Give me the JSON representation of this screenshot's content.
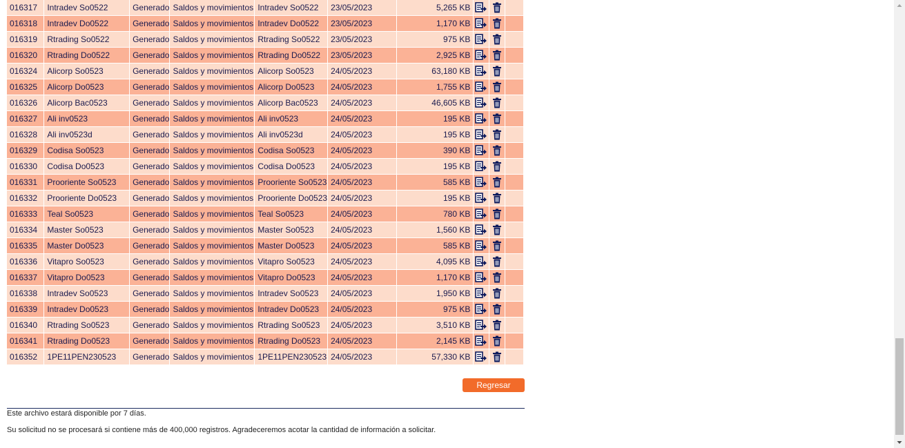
{
  "rows": [
    {
      "id": "016317",
      "name": "Intradev So0522",
      "status": "Generado",
      "type": "Saldos y movimientos",
      "file": "Intradev So0522",
      "date": "23/05/2023",
      "size": "5,265 KB"
    },
    {
      "id": "016318",
      "name": "Intradev Do0522",
      "status": "Generado",
      "type": "Saldos y movimientos",
      "file": "Intradev Do0522",
      "date": "23/05/2023",
      "size": "1,170 KB"
    },
    {
      "id": "016319",
      "name": "Rtrading So0522",
      "status": "Generado",
      "type": "Saldos y movimientos",
      "file": "Rtrading So0522",
      "date": "23/05/2023",
      "size": "975 KB"
    },
    {
      "id": "016320",
      "name": "Rtrading Do0522",
      "status": "Generado",
      "type": "Saldos y movimientos",
      "file": "Rtrading Do0522",
      "date": "23/05/2023",
      "size": "2,925 KB"
    },
    {
      "id": "016324",
      "name": "Alicorp So0523",
      "status": "Generado",
      "type": "Saldos y movimientos",
      "file": "Alicorp So0523",
      "date": "24/05/2023",
      "size": "63,180 KB"
    },
    {
      "id": "016325",
      "name": "Alicorp Do0523",
      "status": "Generado",
      "type": "Saldos y movimientos",
      "file": "Alicorp Do0523",
      "date": "24/05/2023",
      "size": "1,755 KB"
    },
    {
      "id": "016326",
      "name": "Alicorp Bac0523",
      "status": "Generado",
      "type": "Saldos y movimientos",
      "file": "Alicorp Bac0523",
      "date": "24/05/2023",
      "size": "46,605 KB"
    },
    {
      "id": "016327",
      "name": "Ali inv0523",
      "status": "Generado",
      "type": "Saldos y movimientos",
      "file": "Ali inv0523",
      "date": "24/05/2023",
      "size": "195 KB"
    },
    {
      "id": "016328",
      "name": "Ali inv0523d",
      "status": "Generado",
      "type": "Saldos y movimientos",
      "file": "Ali inv0523d",
      "date": "24/05/2023",
      "size": "195 KB"
    },
    {
      "id": "016329",
      "name": "Codisa So0523",
      "status": "Generado",
      "type": "Saldos y movimientos",
      "file": "Codisa So0523",
      "date": "24/05/2023",
      "size": "390 KB"
    },
    {
      "id": "016330",
      "name": "Codisa Do0523",
      "status": "Generado",
      "type": "Saldos y movimientos",
      "file": "Codisa Do0523",
      "date": "24/05/2023",
      "size": "195 KB"
    },
    {
      "id": "016331",
      "name": "Prooriente So0523",
      "status": "Generado",
      "type": "Saldos y movimientos",
      "file": "Prooriente So0523",
      "date": "24/05/2023",
      "size": "585 KB"
    },
    {
      "id": "016332",
      "name": "Prooriente Do0523",
      "status": "Generado",
      "type": "Saldos y movimientos",
      "file": "Prooriente Do0523",
      "date": "24/05/2023",
      "size": "195 KB"
    },
    {
      "id": "016333",
      "name": "Teal So0523",
      "status": "Generado",
      "type": "Saldos y movimientos",
      "file": "Teal So0523",
      "date": "24/05/2023",
      "size": "780 KB"
    },
    {
      "id": "016334",
      "name": "Master So0523",
      "status": "Generado",
      "type": "Saldos y movimientos",
      "file": "Master So0523",
      "date": "24/05/2023",
      "size": "1,560 KB"
    },
    {
      "id": "016335",
      "name": "Master Do0523",
      "status": "Generado",
      "type": "Saldos y movimientos",
      "file": "Master Do0523",
      "date": "24/05/2023",
      "size": "585 KB"
    },
    {
      "id": "016336",
      "name": "Vitapro So0523",
      "status": "Generado",
      "type": "Saldos y movimientos",
      "file": "Vitapro So0523",
      "date": "24/05/2023",
      "size": "4,095 KB"
    },
    {
      "id": "016337",
      "name": "Vitapro Do0523",
      "status": "Generado",
      "type": "Saldos y movimientos",
      "file": "Vitapro Do0523",
      "date": "24/05/2023",
      "size": "1,170 KB"
    },
    {
      "id": "016338",
      "name": "Intradev So0523",
      "status": "Generado",
      "type": "Saldos y movimientos",
      "file": "Intradev So0523",
      "date": "24/05/2023",
      "size": "1,950 KB"
    },
    {
      "id": "016339",
      "name": "Intradev Do0523",
      "status": "Generado",
      "type": "Saldos y movimientos",
      "file": "Intradev Do0523",
      "date": "24/05/2023",
      "size": "975 KB"
    },
    {
      "id": "016340",
      "name": "Rtrading So0523",
      "status": "Generado",
      "type": "Saldos y movimientos",
      "file": "Rtrading So0523",
      "date": "24/05/2023",
      "size": "3,510 KB"
    },
    {
      "id": "016341",
      "name": "Rtrading Do0523",
      "status": "Generado",
      "type": "Saldos y movimientos",
      "file": "Rtrading Do0523",
      "date": "24/05/2023",
      "size": "2,145 KB"
    },
    {
      "id": "016352",
      "name": "1PE11PEN230523",
      "status": "Generado",
      "type": "Saldos y movimientos",
      "file": "1PE11PEN230523",
      "date": "24/05/2023",
      "size": "57,330 KB"
    }
  ],
  "icons": {
    "export": "export-file-icon",
    "delete": "trash-icon"
  },
  "actions": {
    "back_label": "Regresar"
  },
  "footer": {
    "availability_note": "Este archivo estará disponible por 7 días.",
    "limit_note": "Su solicitud no se procesará si contiene más de 400,000 registros. Agradeceremos acotar la cantidad de información a solicitar."
  },
  "colors": {
    "row_light": "#fddccb",
    "row_dark": "#fbb296",
    "text": "#1a1a4e",
    "button": "#f26b2a",
    "icon": "#0d1a5c"
  }
}
